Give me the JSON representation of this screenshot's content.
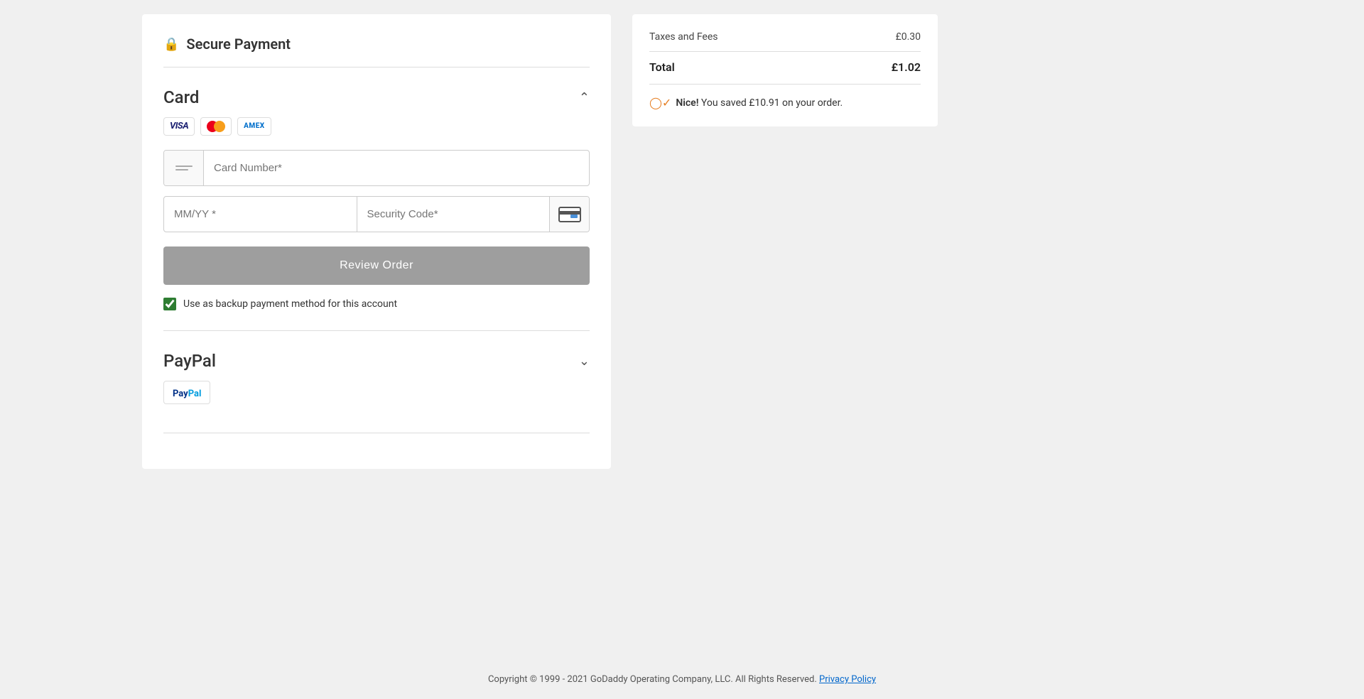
{
  "header": {
    "title": "Secure Payment",
    "lock_icon": "🔒"
  },
  "card_section": {
    "title": "Card",
    "card_number_placeholder": "Card Number*",
    "expiry_placeholder": "MM/YY *",
    "security_placeholder": "Security Code*",
    "review_button_label": "Review Order",
    "backup_checkbox_label": "Use as backup payment method for this account",
    "logos": [
      "VISA",
      "MC",
      "AMEX"
    ]
  },
  "paypal_section": {
    "title": "PayPal"
  },
  "right_panel": {
    "taxes_fees_label": "Taxes and Fees",
    "taxes_fees_value": "£0.30",
    "total_label": "Total",
    "total_value": "£1.02",
    "savings_prefix": "Nice!",
    "savings_text": "You saved £10.91 on your order."
  },
  "footer": {
    "copyright": "Copyright © 1999 - 2021 GoDaddy Operating Company, LLC. All Rights Reserved.",
    "privacy_link": "Privacy Policy",
    "privacy_href": "#"
  }
}
